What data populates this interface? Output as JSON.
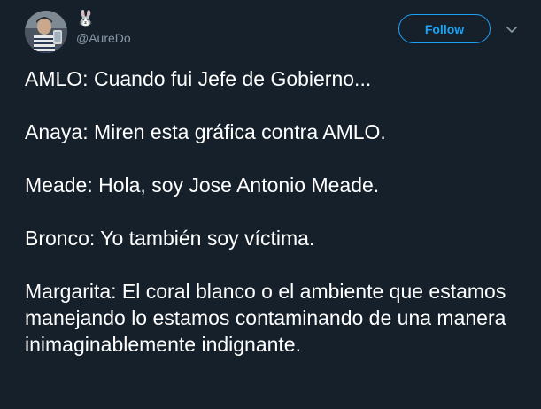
{
  "tweet": {
    "author": {
      "display_name": "🐰",
      "handle": "@AureDo"
    },
    "follow_label": "Follow",
    "lines": [
      "AMLO: Cuando fui Jefe de Gobierno...",
      "Anaya: Miren esta gráfica contra AMLO.",
      "Meade: Hola, soy Jose Antonio Meade.",
      "Bronco: Yo también soy víctima.",
      "Margarita: El coral blanco o el ambiente que estamos manejando lo estamos contaminando de una manera inimaginablemente indignante."
    ]
  },
  "colors": {
    "background": "#15202b",
    "accent": "#1da1f2",
    "text": "#ffffff",
    "muted": "#8899a6"
  }
}
